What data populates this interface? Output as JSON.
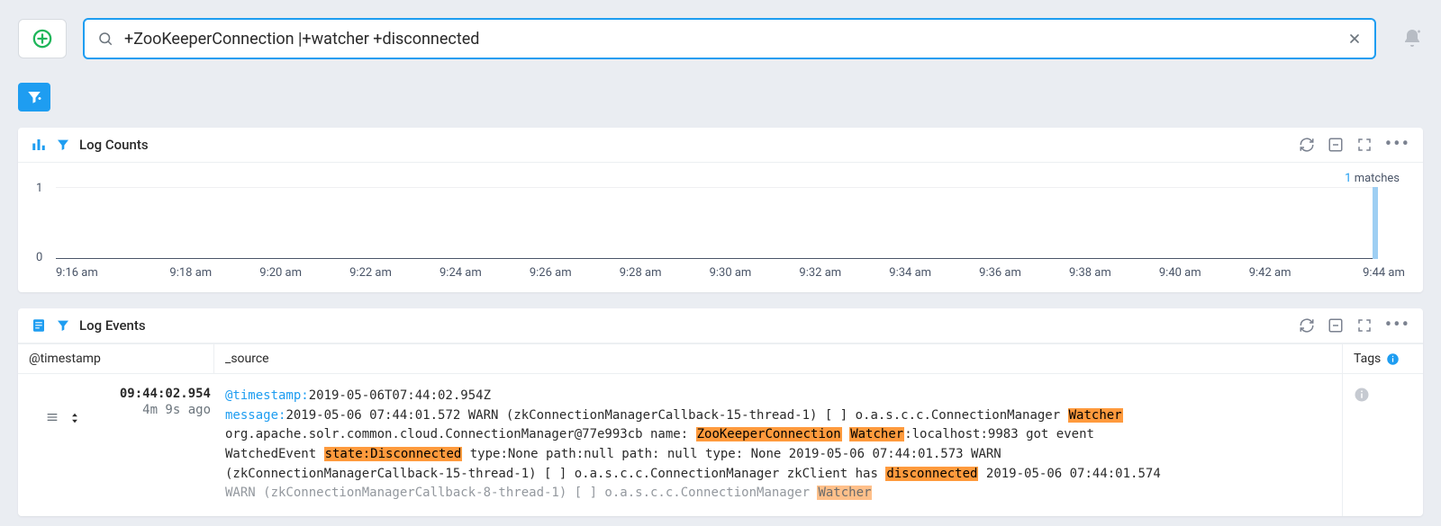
{
  "search": {
    "value": "+ZooKeeperConnection |+watcher +disconnected"
  },
  "panels": {
    "counts_title": "Log Counts",
    "events_title": "Log Events",
    "matches_label": "matches",
    "matches_count": "1"
  },
  "columns": {
    "timestamp": "@timestamp",
    "source": "_source",
    "tags": "Tags"
  },
  "chart_data": {
    "type": "bar",
    "title": "Log Counts",
    "xlabel": "",
    "ylabel": "",
    "ylim": [
      0,
      1
    ],
    "y_ticks": [
      0,
      1
    ],
    "x_ticks": [
      "9:16 am",
      "9:18 am",
      "9:20 am",
      "9:22 am",
      "9:24 am",
      "9:26 am",
      "9:28 am",
      "9:30 am",
      "9:32 am",
      "9:34 am",
      "9:36 am",
      "9:38 am",
      "9:40 am",
      "9:42 am",
      "9:44 am"
    ],
    "categories": [
      "9:44 am"
    ],
    "values": [
      1
    ]
  },
  "event": {
    "ts": "09:44:02.954",
    "ago": "4m 9s ago",
    "ts_field": "@timestamp:",
    "ts_value": "2019-05-06T07:44:02.954Z",
    "msg_field": "message:",
    "msg_l1_a": "2019-05-06 07:44:01.572 WARN (zkConnectionManagerCallback-15-thread-1) [ ] o.a.s.c.c.ConnectionManager ",
    "msg_l1_h1": "Watcher",
    "msg_l2_a": "org.apache.solr.common.cloud.ConnectionManager@77e993cb name: ",
    "msg_l2_h1": "ZooKeeperConnection",
    "msg_l2_b": " ",
    "msg_l2_h2": "Watcher",
    "msg_l2_c": ":localhost:9983 got event",
    "msg_l3_a": "WatchedEvent ",
    "msg_l3_h1": "state:Disconnected",
    "msg_l3_b": " type:None path:null path: null type: None 2019-05-06 07:44:01.573 WARN",
    "msg_l4_a": "(zkConnectionManagerCallback-15-thread-1) [ ] o.a.s.c.c.ConnectionManager zkClient has ",
    "msg_l4_h1": "disconnected",
    "msg_l4_b": " 2019-05-06 07:44:01.574",
    "msg_l5_a": "WARN (zkConnectionManagerCallback-8-thread-1) [ ] o.a.s.c.c.ConnectionManager ",
    "msg_l5_h1": "Watcher"
  },
  "colors": {
    "accent": "#1e9df1",
    "highlight": "#ff9a3d"
  }
}
